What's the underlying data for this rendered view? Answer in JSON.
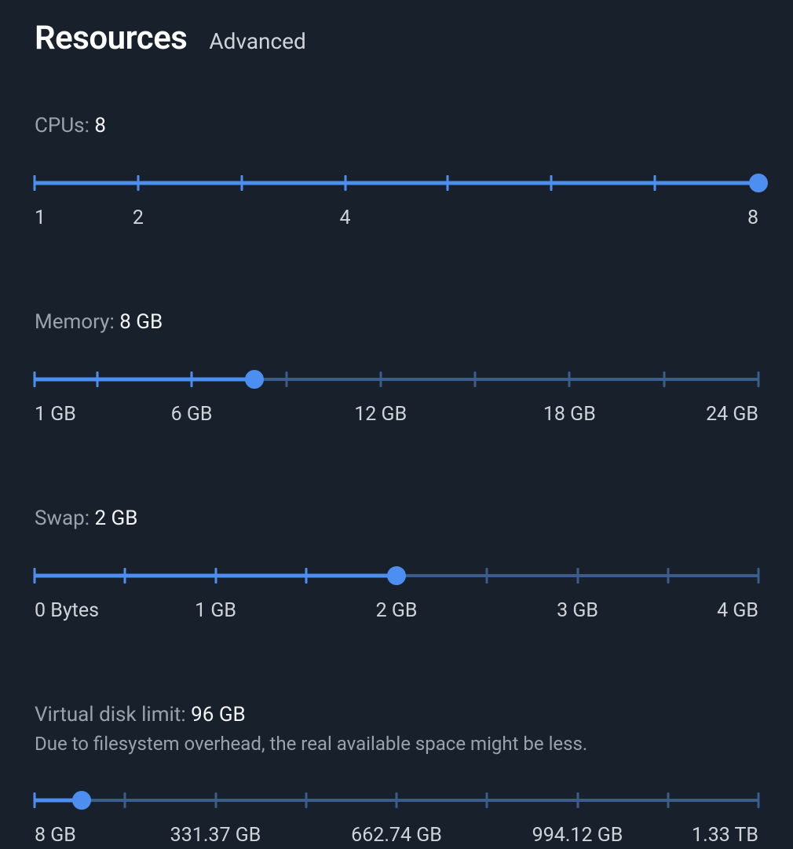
{
  "header": {
    "title": "Resources",
    "subtitle": "Advanced"
  },
  "settings": [
    {
      "id": "cpus",
      "label": "CPUs:",
      "value": "8",
      "help": "",
      "thumbPercent": 100,
      "ticks": [
        {
          "pos": 0,
          "label": "1",
          "labelAlign": "first"
        },
        {
          "pos": 14.3,
          "label": "2"
        },
        {
          "pos": 28.6,
          "label": ""
        },
        {
          "pos": 42.9,
          "label": "4"
        },
        {
          "pos": 57.1,
          "label": ""
        },
        {
          "pos": 71.4,
          "label": ""
        },
        {
          "pos": 85.7,
          "label": ""
        },
        {
          "pos": 100,
          "label": "8",
          "labelAlign": "last"
        }
      ]
    },
    {
      "id": "memory",
      "label": "Memory:",
      "value": "8 GB",
      "help": "",
      "thumbPercent": 30.4,
      "ticks": [
        {
          "pos": 0,
          "label": "1 GB",
          "labelAlign": "first"
        },
        {
          "pos": 8.7,
          "label": ""
        },
        {
          "pos": 21.7,
          "label": "6 GB"
        },
        {
          "pos": 34.8,
          "label": ""
        },
        {
          "pos": 47.8,
          "label": "12 GB"
        },
        {
          "pos": 60.9,
          "label": ""
        },
        {
          "pos": 73.9,
          "label": "18 GB"
        },
        {
          "pos": 87.0,
          "label": ""
        },
        {
          "pos": 100,
          "label": "24 GB",
          "labelAlign": "last"
        }
      ]
    },
    {
      "id": "swap",
      "label": "Swap:",
      "value": "2 GB",
      "help": "",
      "thumbPercent": 50,
      "ticks": [
        {
          "pos": 0,
          "label": "0 Bytes",
          "labelAlign": "first"
        },
        {
          "pos": 12.5,
          "label": ""
        },
        {
          "pos": 25,
          "label": "1 GB"
        },
        {
          "pos": 37.5,
          "label": ""
        },
        {
          "pos": 50,
          "label": "2 GB"
        },
        {
          "pos": 62.5,
          "label": ""
        },
        {
          "pos": 75,
          "label": "3 GB"
        },
        {
          "pos": 87.5,
          "label": ""
        },
        {
          "pos": 100,
          "label": "4 GB",
          "labelAlign": "last"
        }
      ]
    },
    {
      "id": "disk",
      "label": "Virtual disk limit:",
      "value": "96 GB",
      "help": "Due to filesystem overhead, the real available space might be less.",
      "thumbPercent": 6.5,
      "ticks": [
        {
          "pos": 0,
          "label": "8 GB",
          "labelAlign": "first"
        },
        {
          "pos": 12.5,
          "label": ""
        },
        {
          "pos": 25,
          "label": "331.37 GB"
        },
        {
          "pos": 37.5,
          "label": ""
        },
        {
          "pos": 50,
          "label": "662.74 GB"
        },
        {
          "pos": 62.5,
          "label": ""
        },
        {
          "pos": 75,
          "label": "994.12 GB"
        },
        {
          "pos": 87.5,
          "label": ""
        },
        {
          "pos": 100,
          "label": "1.33 TB",
          "labelAlign": "last"
        }
      ]
    }
  ]
}
